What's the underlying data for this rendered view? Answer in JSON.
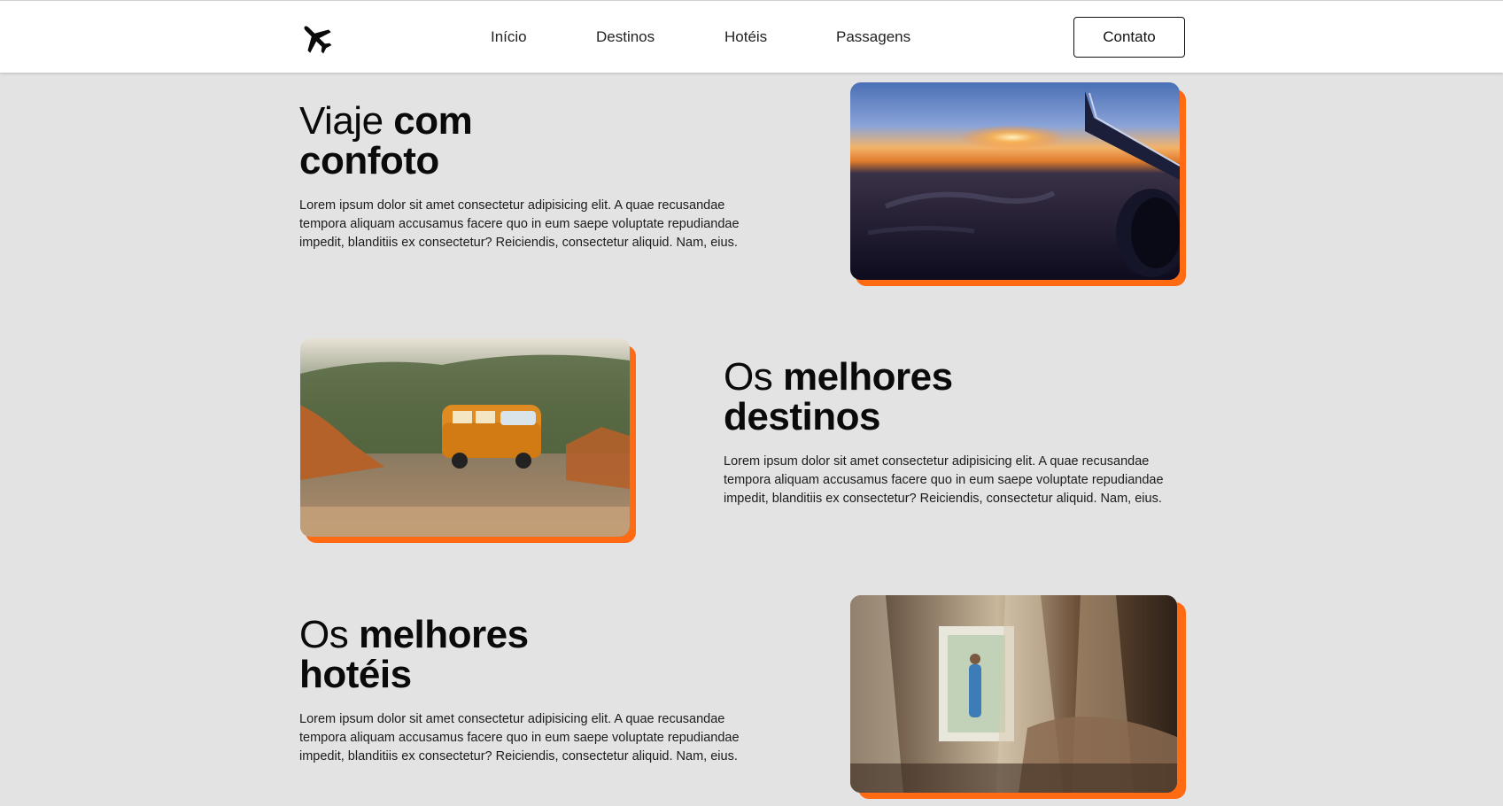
{
  "header": {
    "logo_icon": "airplane-icon",
    "nav": [
      {
        "label": "Início"
      },
      {
        "label": "Destinos"
      },
      {
        "label": "Hotéis"
      },
      {
        "label": "Passagens"
      }
    ],
    "contact_label": "Contato"
  },
  "colors": {
    "accent": "#ff6a13",
    "background": "#e3e3e3",
    "header_bg": "#ffffff",
    "text": "#111111"
  },
  "sections": [
    {
      "title_light": "Viaje ",
      "title_bold_1": "com",
      "title_bold_2": "confoto",
      "text": "Lorem ipsum dolor sit amet consectetur adipisicing elit. A quae recusandae tempora aliquam accusamus facere quo in eum saepe voluptate repudiandae impedit, blanditiis ex consectetur? Reiciendis, consectetur aliquid. Nam, eius.",
      "image": "airplane-wing-sunset-photo"
    },
    {
      "title_light": "Os ",
      "title_bold_1": "melhores",
      "title_bold_2": "destinos",
      "text": "Lorem ipsum dolor sit amet consectetur adipisicing elit. A quae recusandae tempora aliquam accusamus facere quo in eum saepe voluptate repudiandae impedit, blanditiis ex consectetur? Reiciendis, consectetur aliquid. Nam, eius.",
      "image": "orange-van-mountain-photo"
    },
    {
      "title_light": "Os ",
      "title_bold_1": "melhores",
      "title_bold_2": "hotéis",
      "text": "Lorem ipsum dolor sit amet consectetur adipisicing elit. A quae recusandae tempora aliquam accusamus facere quo in eum saepe voluptate repudiandae impedit, blanditiis ex consectetur? Reiciendis, consectetur aliquid. Nam, eius.",
      "image": "hotel-room-canopy-bed-photo"
    }
  ]
}
